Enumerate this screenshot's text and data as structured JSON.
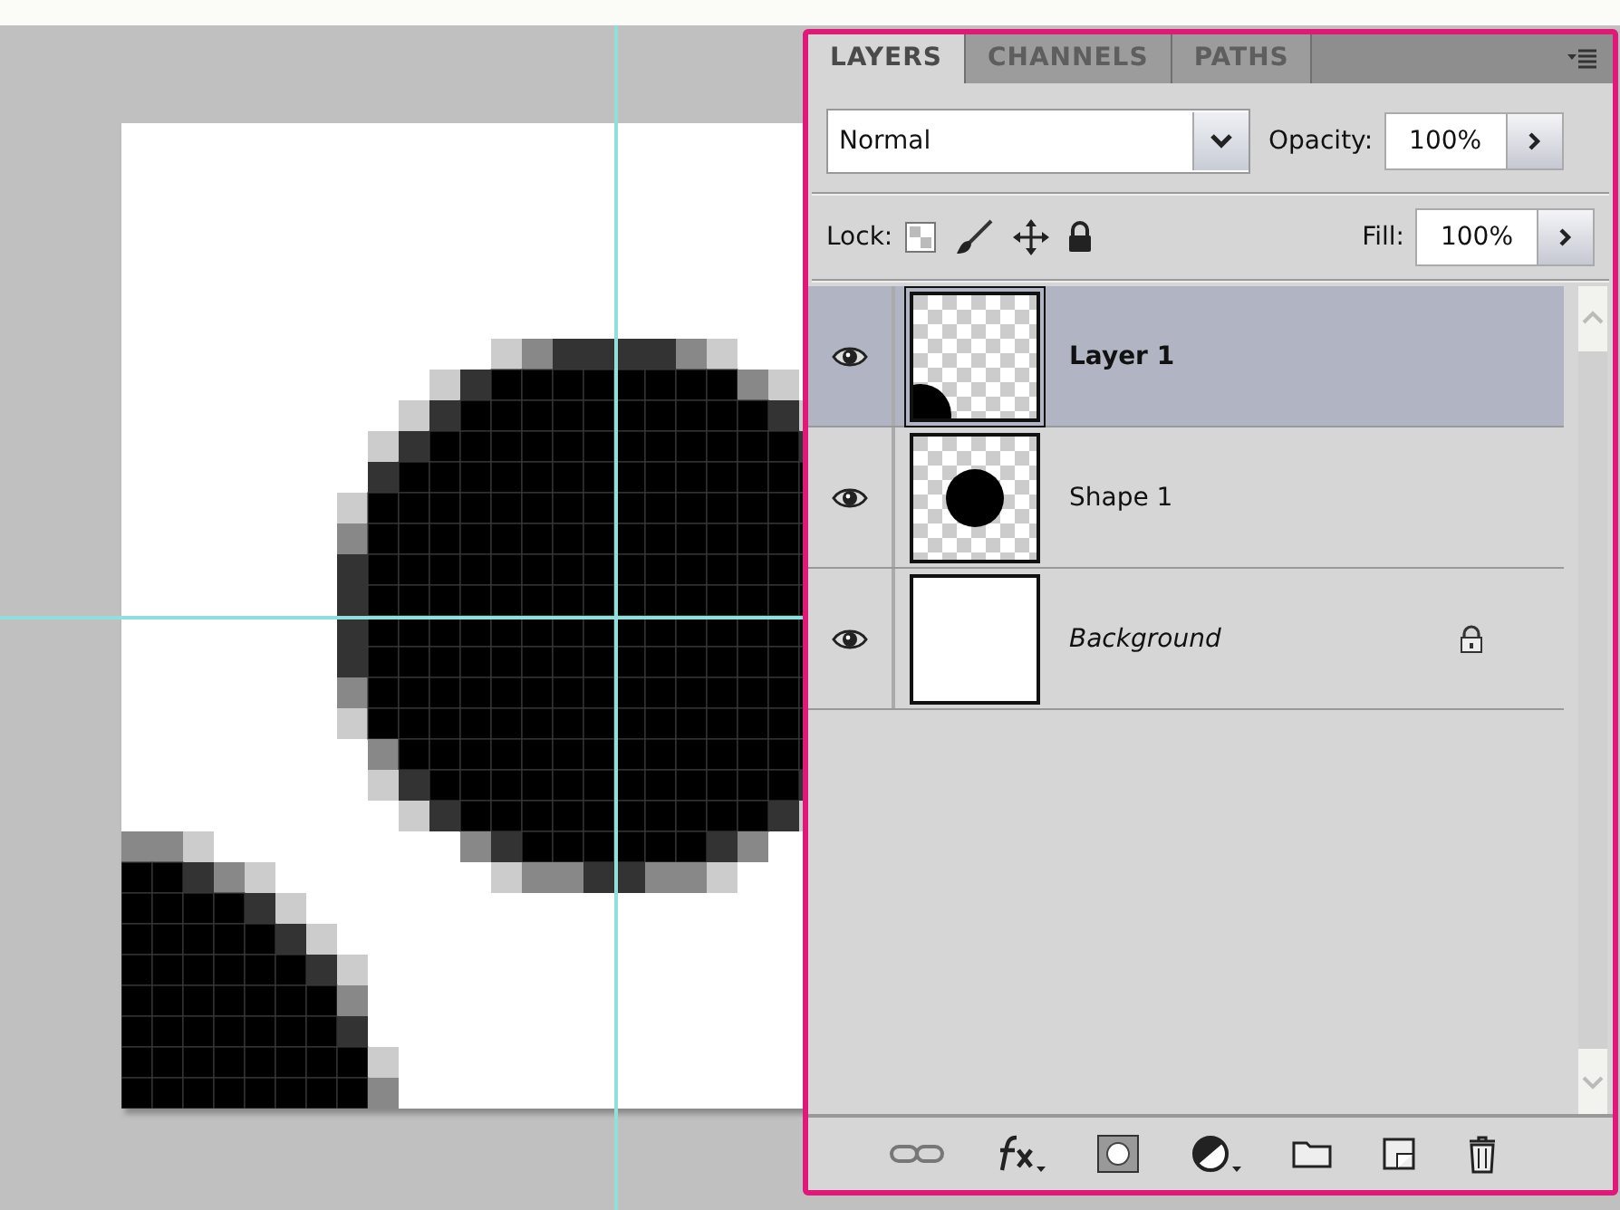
{
  "panel": {
    "tabs": [
      {
        "label": "LAYERS",
        "selected": true
      },
      {
        "label": "CHANNELS",
        "selected": false
      },
      {
        "label": "PATHS",
        "selected": false
      }
    ],
    "blend_mode": {
      "value": "Normal"
    },
    "opacity": {
      "label": "Opacity:",
      "value": "100%"
    },
    "lock": {
      "label": "Lock:"
    },
    "fill": {
      "label": "Fill:",
      "value": "100%"
    },
    "layers": [
      {
        "name": "Layer 1",
        "selected": true,
        "visible": true,
        "locked": false,
        "kind": "corner-shape"
      },
      {
        "name": "Shape 1",
        "selected": false,
        "visible": true,
        "locked": false,
        "kind": "circle-shape"
      },
      {
        "name": "Background",
        "selected": false,
        "visible": true,
        "locked": true,
        "kind": "background"
      }
    ]
  }
}
